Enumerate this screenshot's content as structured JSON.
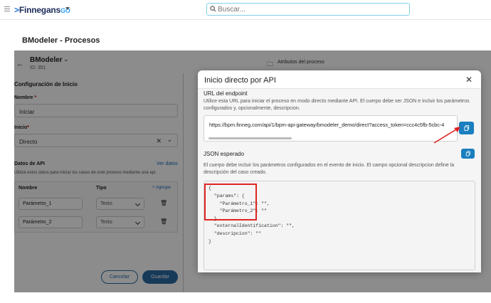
{
  "topbar": {
    "logo": "Finnegans",
    "logo_suffix": "GO",
    "search_placeholder": "Buscar..."
  },
  "page": {
    "title": "BModeler - Procesos"
  },
  "process": {
    "title": "BModeler",
    "id": "ID: 351",
    "attr_label": "Atributos del proceso"
  },
  "config": {
    "title": "Configuración de Inicio",
    "name_label": "Nombre",
    "name_value": "Iniciar",
    "start_label": "Inicio",
    "start_value": "Directo",
    "api_title": "Datos de API",
    "api_link": "Ver datos",
    "api_desc": "Utilizá estos datos para iniciar los casos de este proceso mediante una api.",
    "col_name": "Nombre",
    "col_type": "Tipo",
    "add_label": "+ Agregar",
    "params": [
      {
        "name": "Parámetro_1",
        "type": "Texto"
      },
      {
        "name": "Parámetro_2",
        "type": "Texto"
      }
    ],
    "cancel": "Cancelar",
    "save": "Guardar"
  },
  "modal": {
    "title": "Inicio directo por API",
    "endpoint_title": "URL del endpoint",
    "endpoint_desc_1": "Utilice esta URL para iniciar el proceso en modo directo mediante API. El cuerpo debe ser JSON e incluir los parámetros",
    "endpoint_desc_2": "configurados y, opcionalmente, descripcion.",
    "url": "https://bpm.finneg.com/api/1/bpm-api-gateway/bmodeler_demo/direct?access_token=ccc4c5fb-5cbc-4",
    "json_title": "JSON esperado",
    "json_desc_1": "El cuerpo debe incluir los parámetros configurados en el evento de inicio. El campo opcional descripcion define la",
    "json_desc_2": "descripción del caso creado.",
    "json_lines": [
      "{",
      "  \"params\": {",
      "    \"Parámetro_1\": \"\",",
      "    \"Parámetro_2\": \"\"",
      "  },",
      "  \"externalIdentification\": \"\",",
      "  \"descripcion\": \"\"",
      "}"
    ]
  },
  "colors": {
    "accent": "#1a7fbf",
    "primary": "#2b6aa3",
    "highlight": "#e02424"
  }
}
